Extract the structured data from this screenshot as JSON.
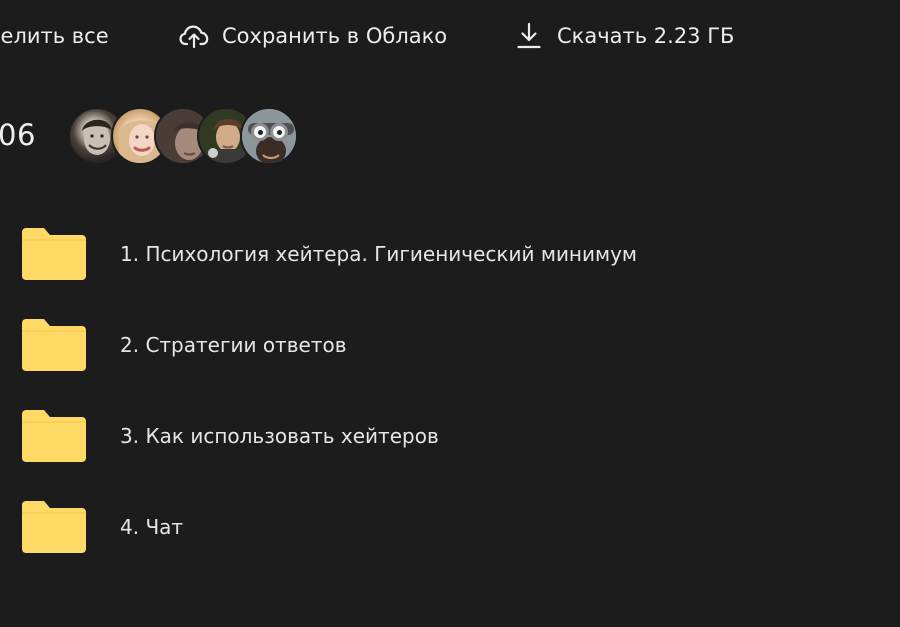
{
  "toolbar": {
    "select_all_label": "делить все",
    "save_to_cloud_label": "Сохранить в Облако",
    "download_label": "Скачать 2.23 ГБ"
  },
  "header": {
    "count_text": "06",
    "avatars": [
      "avatar-1",
      "avatar-2",
      "avatar-3",
      "avatar-4",
      "avatar-5"
    ]
  },
  "folders": [
    {
      "name": "1. Психология хейтера. Гигиенический минимум"
    },
    {
      "name": "2. Стратегии ответов"
    },
    {
      "name": "3. Как использовать хейтеров"
    },
    {
      "name": "4. Чат"
    }
  ],
  "colors": {
    "background": "#1c1c1c",
    "text": "#e8e8e8",
    "folder": "#ffd966"
  },
  "icons": {
    "cloud": "cloud-upload-icon",
    "download": "download-icon",
    "folder": "folder-icon"
  }
}
